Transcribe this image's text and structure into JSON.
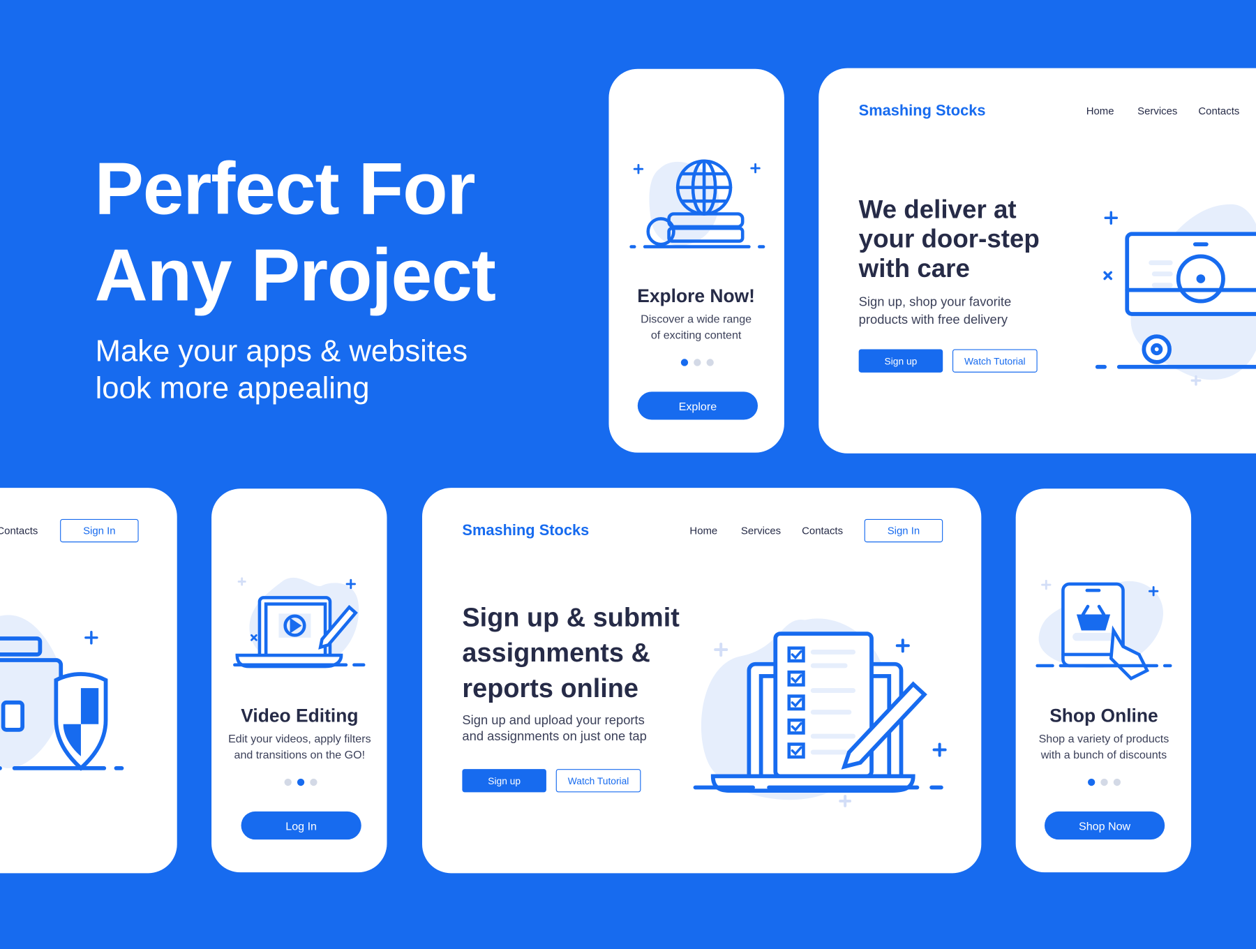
{
  "hero": {
    "title_line1": "Perfect For",
    "title_line2": "Any Project",
    "subtitle_line1": "Make your apps & websites",
    "subtitle_line2": "look more appealing"
  },
  "colors": {
    "background": "#176bef",
    "accent": "#176bef",
    "heading": "#262b47",
    "illustration_fill": "#e6eefc"
  },
  "explore_card": {
    "illustration": "globe-on-books-icon",
    "title": "Explore Now!",
    "desc_line1": "Discover a wide range",
    "desc_line2": "of exciting content",
    "active_dot": 1,
    "button": "Explore"
  },
  "delivery_card": {
    "brand": "Smashing Stocks",
    "nav": [
      "Home",
      "Services",
      "Contacts"
    ],
    "heading_line1": "We deliver at",
    "heading_line2": "your door-step",
    "heading_line3": "with care",
    "desc_line1": "Sign up, shop your favorite",
    "desc_line2": "products with free delivery",
    "primary_button": "Sign up",
    "secondary_button": "Watch Tutorial",
    "illustration": "delivery-truck-stopwatch-icon"
  },
  "security_card": {
    "nav_contacts": "Contacts",
    "sign_in": "Sign In",
    "illustration": "briefcase-shield-icon"
  },
  "video_card": {
    "illustration": "laptop-video-pencil-icon",
    "title": "Video Editing",
    "desc_line1": "Edit your videos, apply filters",
    "desc_line2": "and transitions on the GO!",
    "active_dot": 2,
    "button": "Log In"
  },
  "assignments_card": {
    "brand": "Smashing Stocks",
    "nav": [
      "Home",
      "Services",
      "Contacts"
    ],
    "sign_in": "Sign In",
    "heading_line1": "Sign up & submit",
    "heading_line2": "assignments &",
    "heading_line3": "reports online",
    "desc_line1": "Sign up and upload your reports",
    "desc_line2": "and assignments on just one tap",
    "primary_button": "Sign up",
    "secondary_button": "Watch Tutorial",
    "illustration": "checklist-laptop-pencil-icon"
  },
  "shop_card": {
    "illustration": "phone-basket-hand-icon",
    "title": "Shop Online",
    "desc_line1": "Shop a variety of products",
    "desc_line2": "with a bunch of discounts",
    "active_dot": 1,
    "button": "Shop Now"
  }
}
